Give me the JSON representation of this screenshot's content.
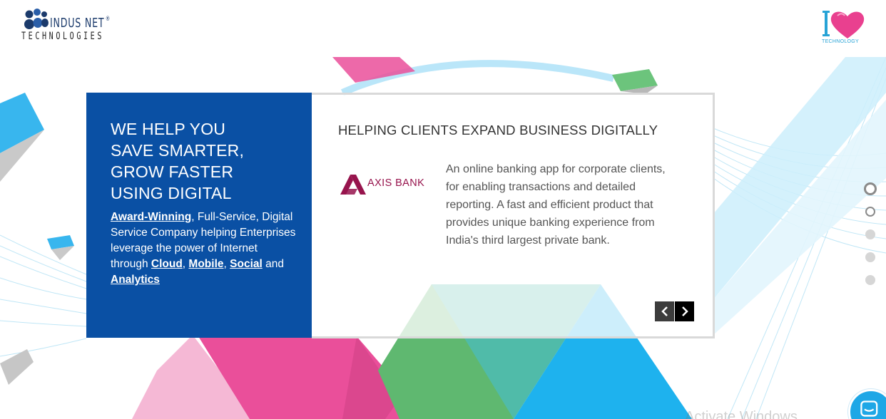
{
  "header": {
    "brand_name_top": "INDUS NET",
    "brand_reg": "®",
    "brand_name_bottom": "TECHNOLOGIES",
    "tagline_logo_text": "TECHNOLOGY"
  },
  "hero": {
    "title_lines": [
      "WE HELP YOU",
      "SAVE SMARTER,",
      "GROW FASTER",
      "USING DIGITAL"
    ],
    "link_award": "Award-Winning",
    "text_1": ", Full-Service, Digital Service Company helping Enterprises leverage the power of Internet through ",
    "link_cloud": "Cloud",
    "sep_1": ", ",
    "link_mobile": "Mobile",
    "sep_2": ", ",
    "link_social": "Social",
    "sep_3": " and ",
    "link_analytics": "Analytics"
  },
  "slide": {
    "heading": "HELPING CLIENTS EXPAND BUSINESS DIGITALLY",
    "client_name": "AXIS BANK",
    "description": "An online banking app for corporate clients, for enabling transactions and detailed reporting. A fast and efficient product that provides unique banking experience from India's third largest private bank.",
    "prev_icon": "chevron-left-icon",
    "next_icon": "chevron-right-icon"
  },
  "page_dots": {
    "count": 5,
    "active_index": 0
  },
  "watermark": "Activate Windows",
  "colors": {
    "hero_blue": "#0a50a4",
    "axis_maroon": "#97144d",
    "pink": "#e9408f",
    "green": "#5cbf6e",
    "sky": "#1eb2ee"
  }
}
